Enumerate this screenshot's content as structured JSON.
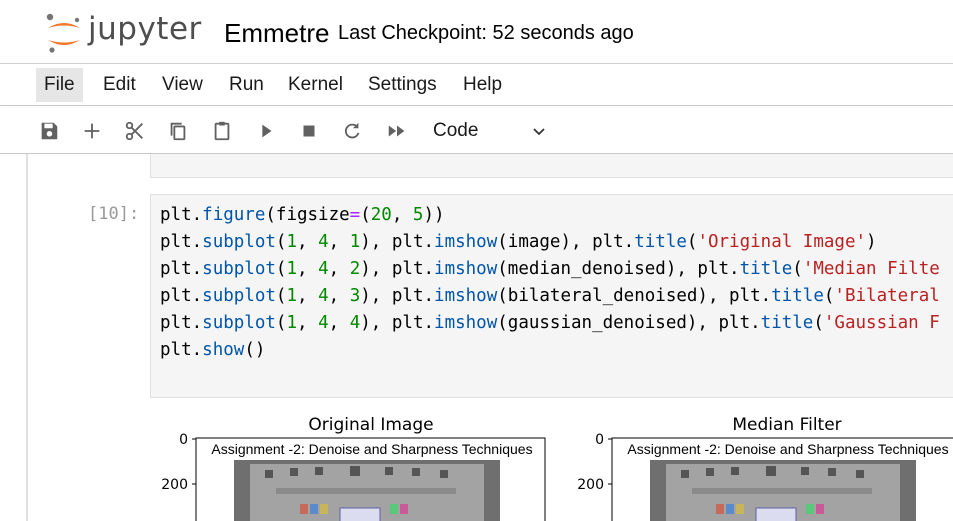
{
  "header": {
    "logo_text": "jupyter",
    "notebook_title": "Emmetre",
    "checkpoint": "Last Checkpoint: 52 seconds ago"
  },
  "menu": {
    "items": [
      "File",
      "Edit",
      "View",
      "Run",
      "Kernel",
      "Settings",
      "Help"
    ],
    "active": "File"
  },
  "toolbar": {
    "buttons": [
      "save-icon",
      "add-icon",
      "cut-icon",
      "copy-icon",
      "paste-icon",
      "run-icon",
      "stop-icon",
      "restart-icon",
      "fast-forward-icon"
    ],
    "cell_type": "Code"
  },
  "cell": {
    "prompt": "[10]:",
    "lines": [
      "plt.figure(figsize=(20, 5))",
      "plt.subplot(1, 4, 1), plt.imshow(image), plt.title('Original Image')",
      "plt.subplot(1, 4, 2), plt.imshow(median_denoised), plt.title('Median Filte",
      "plt.subplot(1, 4, 3), plt.imshow(bilateral_denoised), plt.title('Bilateral",
      "plt.subplot(1, 4, 4), plt.imshow(gaussian_denoised), plt.title('Gaussian F",
      "plt.show()"
    ]
  },
  "output": {
    "plots": [
      {
        "title": "Original Image",
        "yticks": [
          "0",
          "200"
        ],
        "inner_text": "Assignment -2: Denoise and Sharpness Techniques"
      },
      {
        "title": "Median Filter",
        "yticks": [
          "0",
          "200"
        ],
        "inner_text": "Assignment -2: Denoise and Sharpness Techniques"
      }
    ]
  },
  "colors": {
    "logo_orange": "#F37726",
    "keyword_fn": "#0055aa",
    "number": "#008800",
    "string": "#ba2121",
    "operator": "#aa22ff"
  }
}
